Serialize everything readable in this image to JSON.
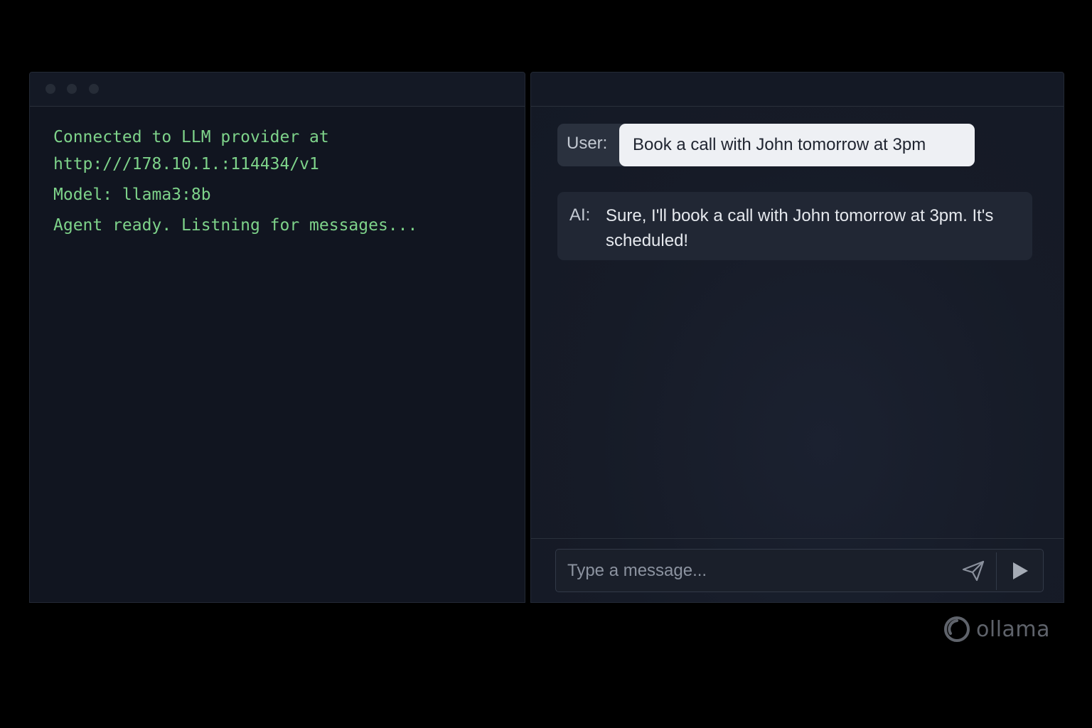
{
  "terminal": {
    "lines": [
      "Connected to LLM provider at",
      "http:///178.10.1.:114434/v1",
      "Model: llama3:8b",
      "Agent ready. Listning for messages..."
    ]
  },
  "chat": {
    "messages": [
      {
        "sender_label": "User:",
        "text": "Book a call with John tomorrow at 3pm"
      },
      {
        "sender_label": "AI:",
        "text": "Sure, I'll book a call with John tomorrow at 3pm. It's scheduled!"
      }
    ],
    "composer": {
      "placeholder": "Type a message...",
      "value": ""
    }
  },
  "icons": {
    "send": "paper-plane-icon",
    "submit": "play-triangle-icon",
    "brand": "ollama-logo-icon"
  },
  "brand": {
    "name": "ollama"
  },
  "colors": {
    "terminal_text": "#7ed38a",
    "background": "#000000",
    "panel": "#111520",
    "user_bubble": "#eef0f4"
  }
}
